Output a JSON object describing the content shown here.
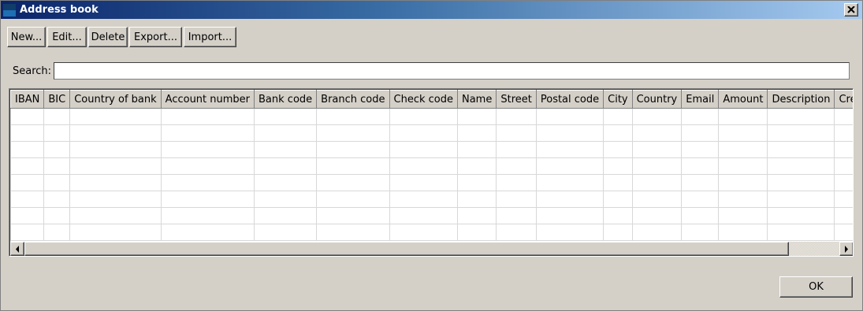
{
  "window": {
    "title": "Address book",
    "app_icon": "app-window-icon",
    "close_icon": "close-icon"
  },
  "toolbar": {
    "new_label": "New...",
    "edit_label": "Edit...",
    "delete_label": "Delete",
    "export_label": "Export...",
    "import_label": "Import..."
  },
  "search": {
    "label": "Search:",
    "value": "",
    "placeholder": ""
  },
  "grid": {
    "columns": [
      "IBAN",
      "BIC",
      "Country of bank",
      "Account number",
      "Bank code",
      "Branch code",
      "Check code",
      "Name",
      "Street",
      "Postal code",
      "City",
      "Country",
      "Email",
      "Amount",
      "Description",
      "Creditor"
    ],
    "rows": []
  },
  "scrollbar": {
    "left_icon": "arrow-left-icon",
    "right_icon": "arrow-right-icon"
  },
  "footer": {
    "ok_label": "OK"
  }
}
